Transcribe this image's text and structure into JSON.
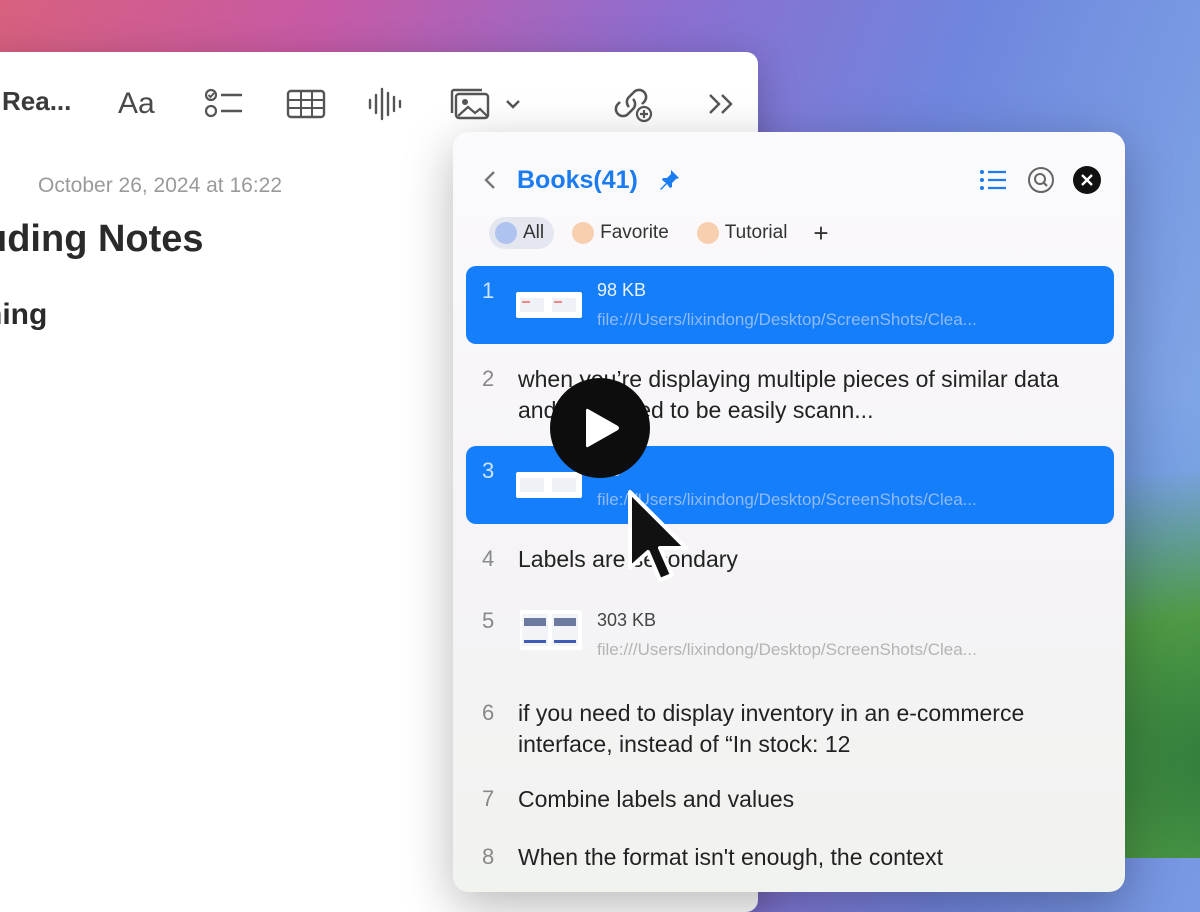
{
  "notes": {
    "toolbar": {
      "title": "Rea...",
      "format_label": "Aa",
      "icons": [
        "checklist-icon",
        "table-icon",
        "audio-icon",
        "media-icon",
        "chevron-down-icon",
        "link-icon",
        "more-icon"
      ]
    },
    "date": "October 26, 2024 at 16:22",
    "title": "uding Notes",
    "subtitle": "hing"
  },
  "panel": {
    "title": "Books(41)",
    "accent": "#1a7cf0",
    "tags": [
      {
        "label": "All",
        "color": "#aec3f0"
      },
      {
        "label": "Favorite",
        "color": "#f7cfae"
      },
      {
        "label": "Tutorial",
        "color": "#f7cfae"
      }
    ],
    "add_tag": "+",
    "items": [
      {
        "num": "1",
        "size": "98 KB",
        "path": "file:///Users/lixindong/Desktop/ScreenShots/Clea..."
      },
      {
        "num": "2",
        "text": "when you’re displaying multiple pieces of similar data and they need to be easily scann..."
      },
      {
        "num": "3",
        "size": "KB",
        "path": "file:///Users/lixindong/Desktop/ScreenShots/Clea..."
      },
      {
        "num": "4",
        "text": "Labels are secondary"
      },
      {
        "num": "5",
        "size": "303 KB",
        "path": "file:///Users/lixindong/Desktop/ScreenShots/Clea..."
      },
      {
        "num": "6",
        "text": "if you need to display inventory in an e-commerce interface, instead of “In stock: 12"
      },
      {
        "num": "7",
        "text": "Combine labels and values"
      },
      {
        "num": "8",
        "text": "When the format isn't enough, the context"
      }
    ],
    "selection_color": "#157efb"
  },
  "overlay": {
    "play_icon": "play-icon",
    "cursor_icon": "cursor-icon"
  }
}
